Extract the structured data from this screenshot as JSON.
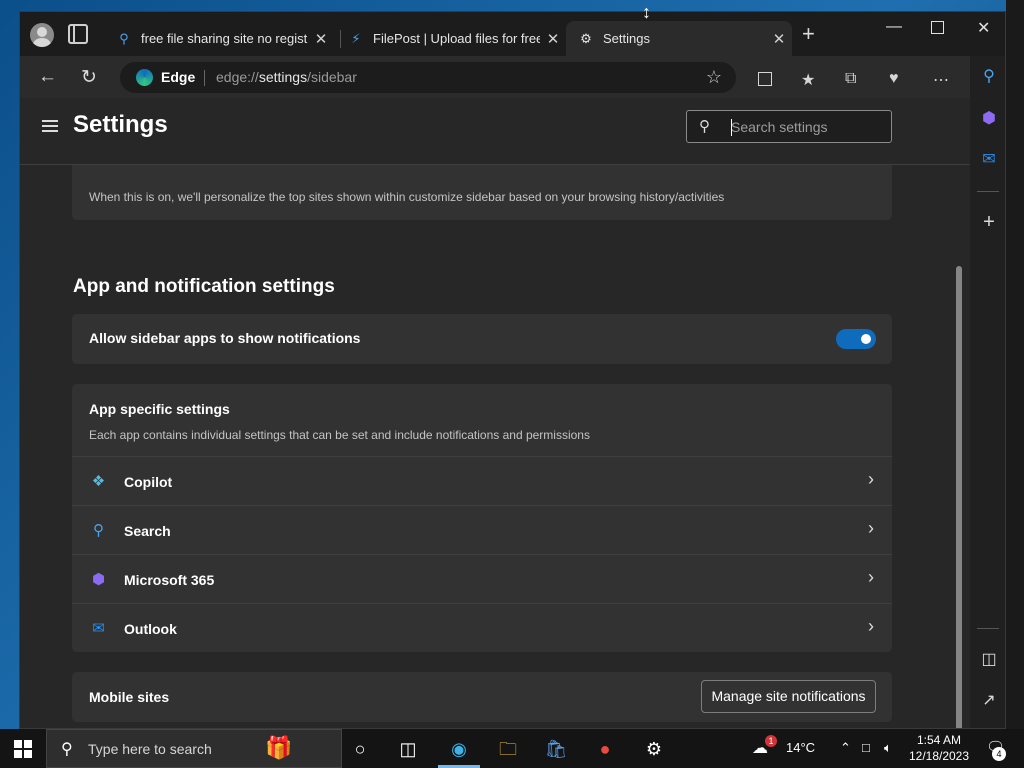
{
  "browser": {
    "tabs": [
      {
        "title": "free file sharing site no registra",
        "icon": "search-icon"
      },
      {
        "title": "FilePost | Upload files for free a",
        "icon": "bolt-icon"
      },
      {
        "title": "Settings",
        "icon": "gear-icon"
      }
    ],
    "address": {
      "brand": "Edge",
      "url_prefix": "edge://",
      "url_path": "settings",
      "url_suffix": "/sidebar"
    }
  },
  "settings": {
    "title": "Settings",
    "search_placeholder": "Search settings",
    "personalize_desc": "When this is on, we'll personalize the top sites shown within customize sidebar based on your browsing history/activities",
    "section_title": "App and notification settings",
    "allow_notifications_label": "Allow sidebar apps to show notifications",
    "app_specific": {
      "title": "App specific settings",
      "description": "Each app contains individual settings that can be set and include notifications and permissions",
      "apps": [
        {
          "name": "Copilot",
          "icon": "copilot-icon"
        },
        {
          "name": "Search",
          "icon": "search-icon"
        },
        {
          "name": "Microsoft 365",
          "icon": "microsoft365-icon"
        },
        {
          "name": "Outlook",
          "icon": "outlook-icon"
        }
      ]
    },
    "mobile_sites_label": "Mobile sites",
    "manage_button": "Manage site notifications"
  },
  "taskbar": {
    "search_placeholder": "Type here to search",
    "weather": "14°C",
    "time": "1:54 AM",
    "date": "12/18/2023",
    "notifications_count": "4",
    "weather_badge": "1"
  },
  "colors": {
    "accent": "#0f6cbd",
    "page_bg": "#272727",
    "card_bg": "#323232"
  }
}
